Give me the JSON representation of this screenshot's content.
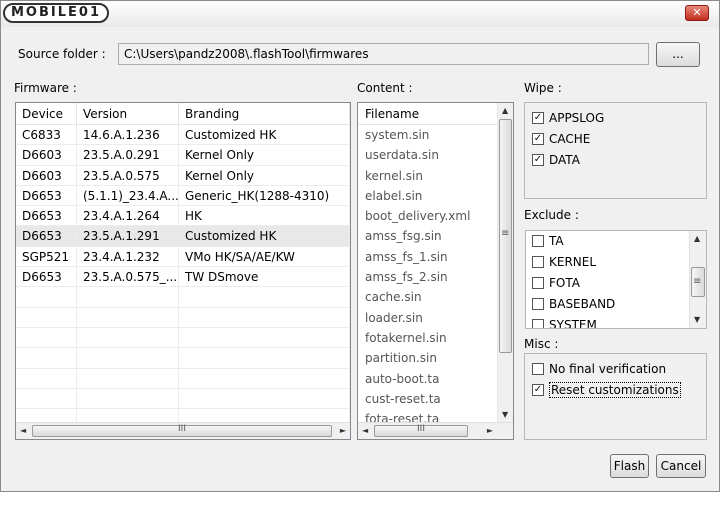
{
  "titlebar": {
    "logo_text": "MOBILE01",
    "close_glyph": "✕"
  },
  "source": {
    "label": "Source folder :",
    "path": "C:\\Users\\pandz2008\\.flashTool\\firmwares",
    "browse_label": "..."
  },
  "firmware": {
    "label": "Firmware :",
    "columns": [
      "Device",
      "Version",
      "Branding"
    ],
    "rows": [
      [
        "C6833",
        "14.6.A.1.236",
        "Customized HK"
      ],
      [
        "D6603",
        "23.5.A.0.291",
        "Kernel Only"
      ],
      [
        "D6603",
        "23.5.A.0.575",
        "Kernel Only"
      ],
      [
        "D6653",
        "(5.1.1)_23.4.A...",
        "Generic_HK(1288-4310)"
      ],
      [
        "D6653",
        "23.4.A.1.264",
        "HK"
      ],
      [
        "D6653",
        "23.5.A.1.291",
        "Customized HK"
      ],
      [
        "SGP521",
        "23.4.A.1.232",
        "VMo HK/SA/AE/KW"
      ],
      [
        "D6653",
        "23.5.A.0.575_...",
        "TW DSmove"
      ]
    ],
    "selected_index": 5
  },
  "content": {
    "label": "Content :",
    "header": "Filename",
    "items": [
      "system.sin",
      "userdata.sin",
      "kernel.sin",
      "elabel.sin",
      "boot_delivery.xml",
      "amss_fsg.sin",
      "amss_fs_1.sin",
      "amss_fs_2.sin",
      "cache.sin",
      "loader.sin",
      "fotakernel.sin",
      "partition.sin",
      "auto-boot.ta",
      "cust-reset.ta",
      "fota-reset.ta"
    ]
  },
  "wipe": {
    "label": "Wipe :",
    "items": [
      {
        "label": "APPSLOG",
        "mark": "✓"
      },
      {
        "label": "CACHE",
        "mark": "✓"
      },
      {
        "label": "DATA",
        "mark": "✓"
      }
    ]
  },
  "exclude": {
    "label": "Exclude :",
    "items": [
      {
        "label": "TA",
        "mark": ""
      },
      {
        "label": "KERNEL",
        "mark": ""
      },
      {
        "label": "FOTA",
        "mark": ""
      },
      {
        "label": "BASEBAND",
        "mark": ""
      },
      {
        "label": "SYSTEM",
        "mark": ""
      }
    ]
  },
  "misc": {
    "label": "Misc :",
    "items": [
      {
        "label": "No final verification",
        "mark": ""
      },
      {
        "label": "Reset customizations",
        "mark": "✓"
      }
    ]
  },
  "scroll": {
    "up": "▲",
    "down": "▼",
    "left": "◄",
    "right": "►",
    "grip_v": "≡",
    "grip_h": "III"
  },
  "buttons": {
    "flash": "Flash",
    "cancel": "Cancel"
  }
}
